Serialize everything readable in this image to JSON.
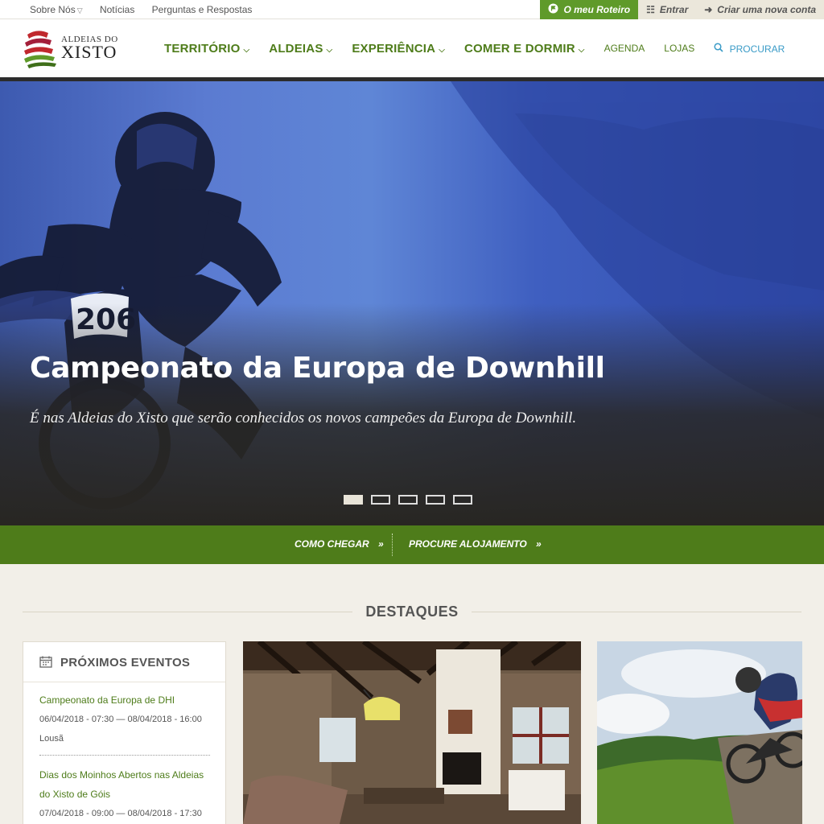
{
  "topbar": {
    "links": [
      "Sobre Nós",
      "Notícias",
      "Perguntas e Respostas"
    ],
    "roteiro": "O meu Roteiro",
    "entrar": "Entrar",
    "criar": "Criar uma nova conta"
  },
  "logo": {
    "line1": "ALDEIAS DO",
    "line2": "XISTO"
  },
  "nav": {
    "main": [
      "TERRITÓRIO",
      "ALDEIAS",
      "EXPERIÊNCIA",
      "COMER E DORMIR"
    ],
    "agenda": "AGENDA",
    "lojas": "LOJAS",
    "procurar": "PROCURAR"
  },
  "hero": {
    "title": "Campeonato da Europa de Downhill",
    "subtitle": "É nas Aldeias do Xisto que serão conhecidos os novos campeões da Europa de Downhill.",
    "number": "206",
    "slides": 5,
    "active_slide": 1
  },
  "strip": {
    "como_chegar": "COMO CHEGAR",
    "alojamento": "PROCURE ALOJAMENTO"
  },
  "destaques": {
    "title": "DESTAQUES"
  },
  "events": {
    "title": "PRÓXIMOS EVENTOS",
    "items": [
      {
        "name": "Campeonato da Europa de DHI",
        "date": "06/04/2018 - 07:30 — 08/04/2018 - 16:00",
        "location": "Lousã"
      },
      {
        "name_line1": "Dias dos Moinhos Abertos nas Aldeias",
        "name_line2": "do Xisto de Góis",
        "date": "07/04/2018 - 09:00 — 08/04/2018 - 17:30"
      }
    ]
  },
  "colors": {
    "green": "#4e7c1a",
    "roteiro_green": "#5f9a2a",
    "hero_blue": "#4a6cc8",
    "beige": "#f2efe8"
  }
}
